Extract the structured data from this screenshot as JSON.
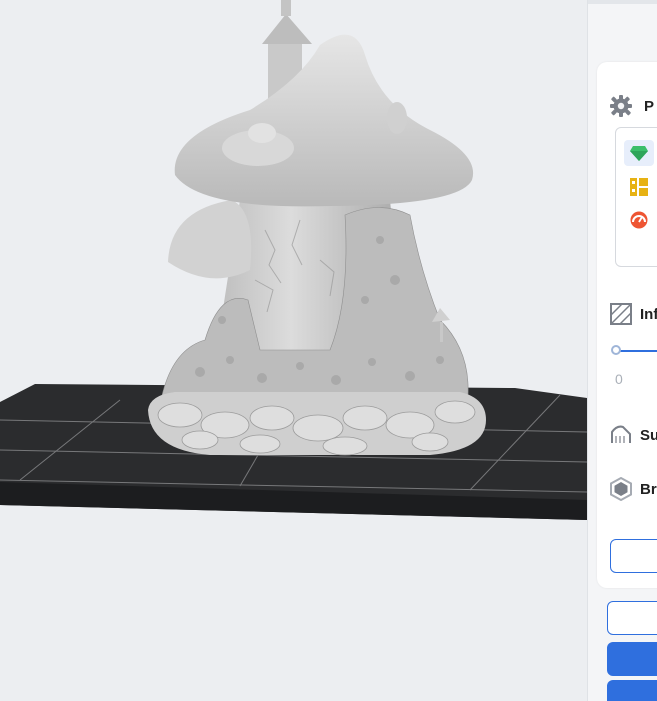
{
  "viewport": {
    "model": "mushroom-house",
    "bed_color": "#2b2c2e",
    "background": "#eceef1"
  },
  "panel": {
    "profile_label": "P",
    "profiles": [
      {
        "icon": "green-gem-icon",
        "color": "#3bbf6a",
        "selected": true
      },
      {
        "icon": "yellow-grid-icon",
        "color": "#e7b213",
        "selected": false
      },
      {
        "icon": "red-dial-icon",
        "color": "#ee5533",
        "selected": false
      }
    ],
    "infill_label": "Inf",
    "infill_value": "0",
    "support_label": "Su",
    "brim_label": "Br",
    "accent": "#2f6fde"
  }
}
